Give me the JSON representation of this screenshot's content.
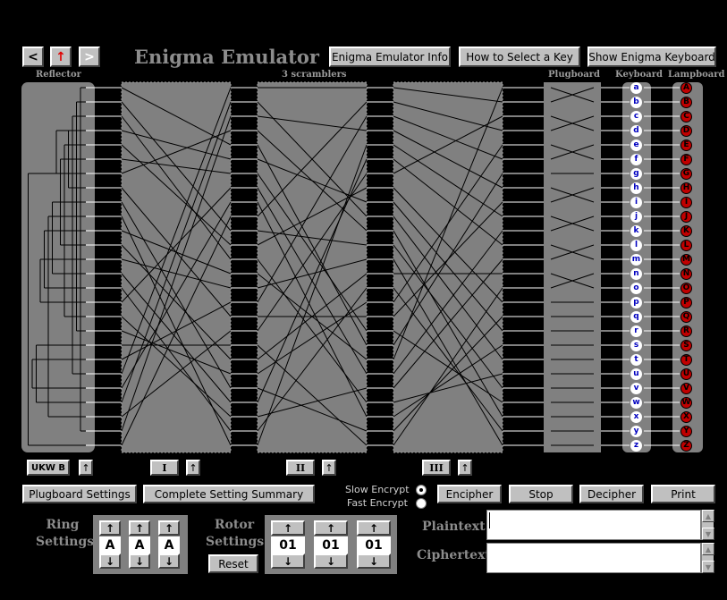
{
  "nav": {
    "back": "<",
    "up": "↑",
    "forward": ">"
  },
  "title": "Enigma Emulator",
  "header_buttons": {
    "info": "Enigma Emulator Info",
    "select_key": "How to Select a Key",
    "keyboard": "Show Enigma Keyboard"
  },
  "labels": {
    "reflector": "Reflector",
    "scramblers": "3 scramblers",
    "plugboard": "Plugboard",
    "keyboard": "Keyboard",
    "lampboard": "Lampboard"
  },
  "keyboard_letters": [
    "a",
    "b",
    "c",
    "d",
    "e",
    "f",
    "g",
    "h",
    "i",
    "j",
    "k",
    "l",
    "m",
    "n",
    "o",
    "p",
    "q",
    "r",
    "s",
    "t",
    "u",
    "v",
    "w",
    "x",
    "y",
    "z"
  ],
  "lampboard_letters": [
    "A",
    "B",
    "C",
    "D",
    "E",
    "F",
    "G",
    "H",
    "I",
    "J",
    "K",
    "L",
    "M",
    "N",
    "O",
    "P",
    "Q",
    "R",
    "S",
    "T",
    "U",
    "V",
    "W",
    "X",
    "Y",
    "Z"
  ],
  "reflector_name": "UKW B",
  "rotors": [
    {
      "name": "I",
      "arrow": "↑"
    },
    {
      "name": "II",
      "arrow": "↑"
    },
    {
      "name": "III",
      "arrow": "↑"
    }
  ],
  "reflector_arrow": "↑",
  "buttons": {
    "plugboard_settings": "Plugboard Settings",
    "summary": "Complete Setting Summary",
    "encipher": "Encipher",
    "stop": "Stop",
    "decipher": "Decipher",
    "print": "Print",
    "reset": "Reset"
  },
  "encrypt_modes": {
    "slow": "Slow Encrypt",
    "fast": "Fast Encrypt",
    "selected": "slow"
  },
  "ring_settings": {
    "label_line1": "Ring",
    "label_line2": "Settings",
    "values": [
      "A",
      "A",
      "A"
    ],
    "up": "↑",
    "down": "↓"
  },
  "rotor_settings": {
    "label_line1": "Rotor",
    "label_line2": "Settings",
    "values": [
      "01",
      "01",
      "01"
    ],
    "up": "↑",
    "down": "↓"
  },
  "text_fields": {
    "plaintext_label": "Plaintext",
    "ciphertext_label": "Ciphertext",
    "plaintext": "",
    "ciphertext": ""
  },
  "wiring": {
    "reflector_pairs": [
      [
        0,
        24
      ],
      [
        1,
        17
      ],
      [
        2,
        20
      ],
      [
        3,
        7
      ],
      [
        4,
        16
      ],
      [
        5,
        11
      ],
      [
        6,
        3
      ],
      [
        8,
        13
      ],
      [
        9,
        23
      ],
      [
        10,
        14
      ],
      [
        12,
        15
      ],
      [
        18,
        22
      ],
      [
        19,
        21
      ],
      [
        25,
        6
      ]
    ],
    "rotor1": [
      4,
      10,
      12,
      5,
      11,
      6,
      3,
      16,
      21,
      25,
      13,
      19,
      14,
      22,
      24,
      7,
      23,
      20,
      18,
      15,
      0,
      8,
      1,
      17,
      2,
      9
    ],
    "rotor2": [
      0,
      9,
      3,
      10,
      18,
      8,
      17,
      20,
      23,
      1,
      11,
      7,
      22,
      19,
      12,
      2,
      16,
      6,
      25,
      13,
      15,
      24,
      5,
      21,
      14,
      4
    ],
    "rotor3": [
      1,
      3,
      5,
      7,
      9,
      11,
      2,
      15,
      17,
      19,
      23,
      21,
      25,
      13,
      24,
      4,
      8,
      22,
      6,
      0,
      10,
      12,
      20,
      18,
      16,
      14
    ],
    "plugboard": [
      1,
      0,
      3,
      2,
      5,
      4,
      6,
      8,
      7,
      10,
      9,
      12,
      11,
      14,
      13,
      15,
      16,
      17,
      18,
      19,
      20,
      21,
      22,
      23,
      24,
      25
    ]
  },
  "colors": {
    "panel": "#808080",
    "lamp": "#c00000",
    "key_text": "#0000c0"
  }
}
